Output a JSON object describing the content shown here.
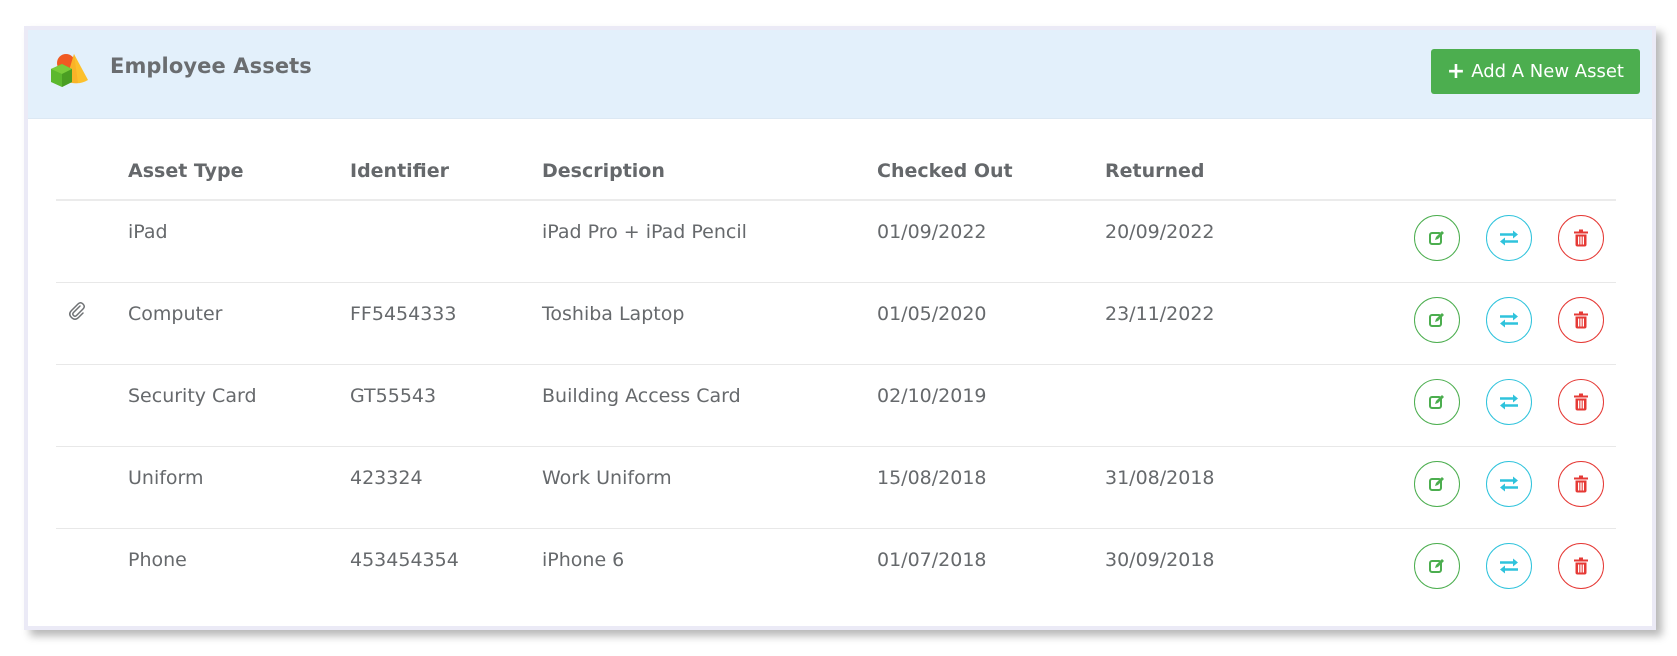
{
  "header": {
    "title": "Employee Assets",
    "logo_icon": "shapes-icon",
    "add_button_label": "Add A New Asset",
    "add_button_icon": "plus-icon"
  },
  "colors": {
    "header_bg": "#e3f0fb",
    "primary_green": "#4cae4f",
    "edit": "#4cae4f",
    "transfer": "#2fc3dc",
    "delete": "#e53935"
  },
  "table": {
    "columns": [
      "",
      "Asset Type",
      "Identifier",
      "Description",
      "Checked Out",
      "Returned",
      ""
    ],
    "rows": [
      {
        "attachment": false,
        "asset_type": "iPad",
        "identifier": "",
        "description": "iPad Pro + iPad Pencil",
        "checked_out": "01/09/2022",
        "returned": "20/09/2022"
      },
      {
        "attachment": true,
        "asset_type": "Computer",
        "identifier": "FF5454333",
        "description": "Toshiba Laptop",
        "checked_out": "01/05/2020",
        "returned": "23/11/2022"
      },
      {
        "attachment": false,
        "asset_type": "Security Card",
        "identifier": "GT55543",
        "description": "Building Access Card",
        "checked_out": "02/10/2019",
        "returned": ""
      },
      {
        "attachment": false,
        "asset_type": "Uniform",
        "identifier": "423324",
        "description": "Work Uniform",
        "checked_out": "15/08/2018",
        "returned": "31/08/2018"
      },
      {
        "attachment": false,
        "asset_type": "Phone",
        "identifier": "453454354",
        "description": "iPhone 6",
        "checked_out": "01/07/2018",
        "returned": "30/09/2018"
      }
    ],
    "row_actions": [
      {
        "name": "edit",
        "icon": "edit-icon"
      },
      {
        "name": "transfer",
        "icon": "transfer-icon"
      },
      {
        "name": "delete",
        "icon": "trash-icon"
      }
    ]
  }
}
